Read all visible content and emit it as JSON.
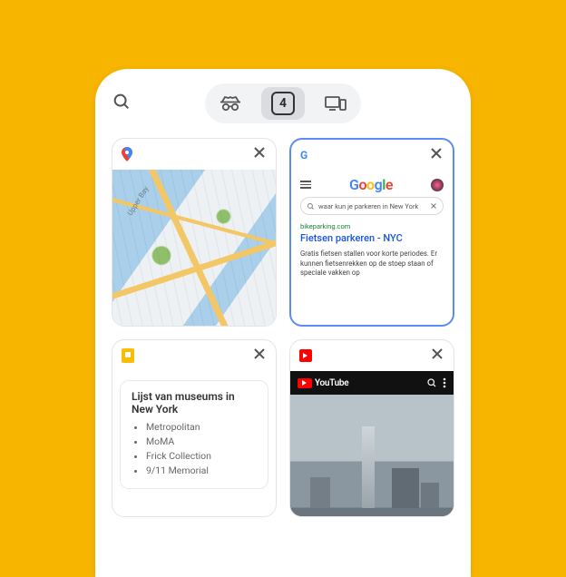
{
  "toolbar": {
    "tab_count": "4"
  },
  "tabs": {
    "maps": {
      "area_label": "Upper Bay"
    },
    "search": {
      "brand": "Google",
      "query": "waar kun je parkeren in New York",
      "result_domain": "bikeparking.com",
      "result_title": "Fietsen parkeren - NYC",
      "result_snippet": "Gratis fietsen stallen voor korte periodes. Er kunnen fietsenrekken op de stoep staan of speciale vakken op"
    },
    "notes": {
      "title": "Lijst van museums in New York",
      "items": [
        "Metropolitan",
        "MoMA",
        "Frick Collection",
        "9/11 Memorial"
      ]
    },
    "youtube": {
      "brand": "YouTube"
    }
  }
}
